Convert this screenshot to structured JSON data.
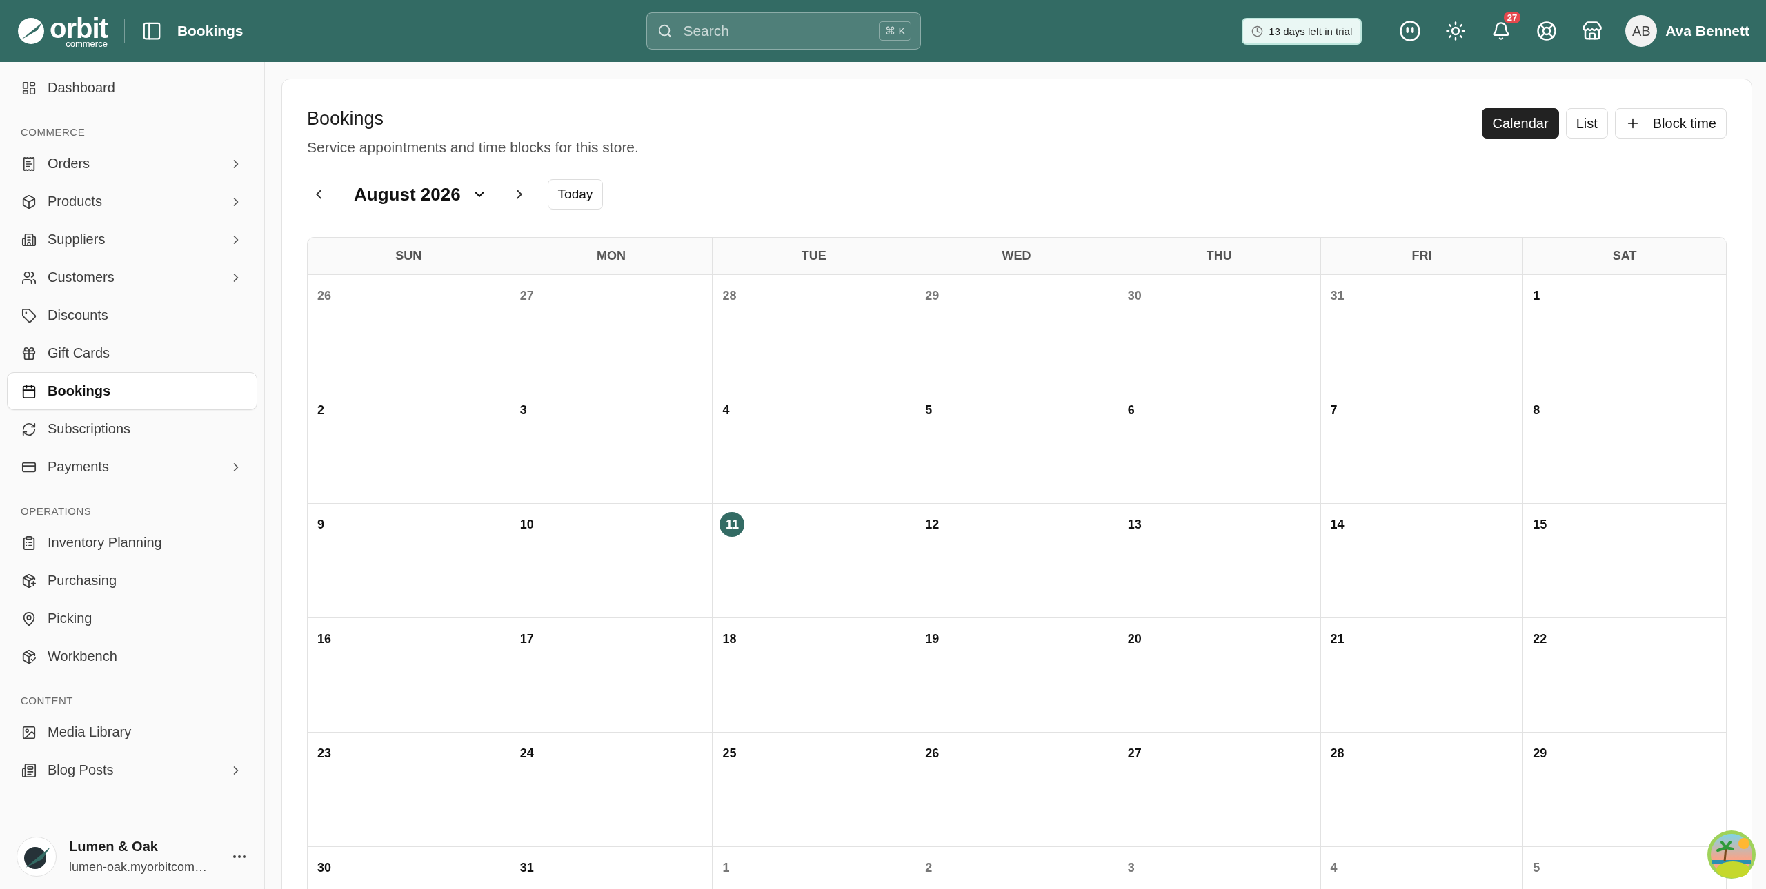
{
  "topbar": {
    "logo": {
      "word": "orbit",
      "sub": "commerce"
    },
    "breadcrumb": "Bookings",
    "search": {
      "placeholder": "Search",
      "shortcut": "⌘ K"
    },
    "trial": "13 days left in trial",
    "notifications": "27",
    "user": {
      "initials": "AB",
      "name": "Ava Bennett"
    }
  },
  "sidebar": {
    "sections": [
      {
        "items": [
          {
            "label": "Dashboard",
            "has_submenu": false,
            "selected": false
          }
        ]
      },
      {
        "title": "COMMERCE",
        "items": [
          {
            "label": "Orders",
            "has_submenu": true,
            "selected": false
          },
          {
            "label": "Products",
            "has_submenu": true,
            "selected": false
          },
          {
            "label": "Suppliers",
            "has_submenu": true,
            "selected": false
          },
          {
            "label": "Customers",
            "has_submenu": true,
            "selected": false
          },
          {
            "label": "Discounts",
            "has_submenu": false,
            "selected": false
          },
          {
            "label": "Gift Cards",
            "has_submenu": false,
            "selected": false
          },
          {
            "label": "Bookings",
            "has_submenu": false,
            "selected": true
          },
          {
            "label": "Subscriptions",
            "has_submenu": false,
            "selected": false
          },
          {
            "label": "Payments",
            "has_submenu": true,
            "selected": false
          }
        ]
      },
      {
        "title": "OPERATIONS",
        "items": [
          {
            "label": "Inventory Planning",
            "has_submenu": false,
            "selected": false
          },
          {
            "label": "Purchasing",
            "has_submenu": false,
            "selected": false
          },
          {
            "label": "Picking",
            "has_submenu": false,
            "selected": false
          },
          {
            "label": "Workbench",
            "has_submenu": false,
            "selected": false
          }
        ]
      },
      {
        "title": "CONTENT",
        "items": [
          {
            "label": "Media Library",
            "has_submenu": false,
            "selected": false
          },
          {
            "label": "Blog Posts",
            "has_submenu": true,
            "selected": false
          }
        ]
      }
    ],
    "store": {
      "name": "Lumen & Oak",
      "domain": "lumen-oak.myorbitcom…"
    }
  },
  "page": {
    "title": "Bookings",
    "subtitle": "Service appointments and time blocks for this store.",
    "views": [
      {
        "label": "Calendar",
        "selected": true
      },
      {
        "label": "List",
        "selected": false
      }
    ],
    "action": "Block time",
    "month": "August 2026",
    "today_button": "Today"
  },
  "calendar": {
    "weekdays": [
      "SUN",
      "MON",
      "TUE",
      "WED",
      "THU",
      "FRI",
      "SAT"
    ],
    "weeks": [
      [
        {
          "label": "26",
          "in_month": false,
          "today": false
        },
        {
          "label": "27",
          "in_month": false,
          "today": false
        },
        {
          "label": "28",
          "in_month": false,
          "today": false
        },
        {
          "label": "29",
          "in_month": false,
          "today": false
        },
        {
          "label": "30",
          "in_month": false,
          "today": false
        },
        {
          "label": "31",
          "in_month": false,
          "today": false
        },
        {
          "label": "1",
          "in_month": true,
          "today": false
        }
      ],
      [
        {
          "label": "2",
          "in_month": true,
          "today": false
        },
        {
          "label": "3",
          "in_month": true,
          "today": false
        },
        {
          "label": "4",
          "in_month": true,
          "today": false
        },
        {
          "label": "5",
          "in_month": true,
          "today": false
        },
        {
          "label": "6",
          "in_month": true,
          "today": false
        },
        {
          "label": "7",
          "in_month": true,
          "today": false
        },
        {
          "label": "8",
          "in_month": true,
          "today": false
        }
      ],
      [
        {
          "label": "9",
          "in_month": true,
          "today": false
        },
        {
          "label": "10",
          "in_month": true,
          "today": false
        },
        {
          "label": "11",
          "in_month": true,
          "today": true
        },
        {
          "label": "12",
          "in_month": true,
          "today": false
        },
        {
          "label": "13",
          "in_month": true,
          "today": false
        },
        {
          "label": "14",
          "in_month": true,
          "today": false
        },
        {
          "label": "15",
          "in_month": true,
          "today": false
        }
      ],
      [
        {
          "label": "16",
          "in_month": true,
          "today": false
        },
        {
          "label": "17",
          "in_month": true,
          "today": false
        },
        {
          "label": "18",
          "in_month": true,
          "today": false
        },
        {
          "label": "19",
          "in_month": true,
          "today": false
        },
        {
          "label": "20",
          "in_month": true,
          "today": false
        },
        {
          "label": "21",
          "in_month": true,
          "today": false
        },
        {
          "label": "22",
          "in_month": true,
          "today": false
        }
      ],
      [
        {
          "label": "23",
          "in_month": true,
          "today": false
        },
        {
          "label": "24",
          "in_month": true,
          "today": false
        },
        {
          "label": "25",
          "in_month": true,
          "today": false
        },
        {
          "label": "26",
          "in_month": true,
          "today": false
        },
        {
          "label": "27",
          "in_month": true,
          "today": false
        },
        {
          "label": "28",
          "in_month": true,
          "today": false
        },
        {
          "label": "29",
          "in_month": true,
          "today": false
        }
      ],
      [
        {
          "label": "30",
          "in_month": true,
          "today": false
        },
        {
          "label": "31",
          "in_month": true,
          "today": false
        },
        {
          "label": "1",
          "in_month": false,
          "today": false
        },
        {
          "label": "2",
          "in_month": false,
          "today": false
        },
        {
          "label": "3",
          "in_month": false,
          "today": false
        },
        {
          "label": "4",
          "in_month": false,
          "today": false
        },
        {
          "label": "5",
          "in_month": false,
          "today": false
        }
      ]
    ]
  }
}
